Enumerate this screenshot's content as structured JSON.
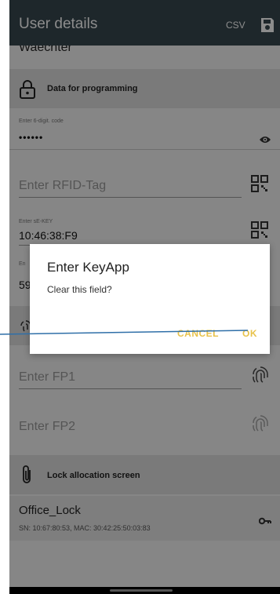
{
  "appbar": {
    "title": "User details",
    "csv_label": "CSV",
    "save_icon": "save-icon"
  },
  "partial_above": "Waechter",
  "programming": {
    "section_title": "Data for programming",
    "code_label": "Enter 6-digit. code",
    "code_value": "••••••",
    "rfid_placeholder": "Enter RFID-Tag",
    "sekey_label": "Enter sE-KEY",
    "sekey_value": "10:46:38:F9",
    "keyapp_label": "En",
    "keyapp_value": "59",
    "fp1_placeholder": "Enter FP1",
    "fp2_placeholder": "Enter FP2"
  },
  "lock_section": {
    "section_title": "Lock allocation screen",
    "lock_name": "Office_Lock",
    "lock_info": "SN: 10:67:80:53, MAC: 30:42:25:50:03:83"
  },
  "dialog": {
    "title": "Enter KeyApp",
    "message": "Clear this field?",
    "cancel_label": "CANCEL",
    "ok_label": "OK"
  },
  "colors": {
    "appbar": "#37474f",
    "accent": "#e8c24a",
    "annotation_line": "#2f6fa8"
  }
}
